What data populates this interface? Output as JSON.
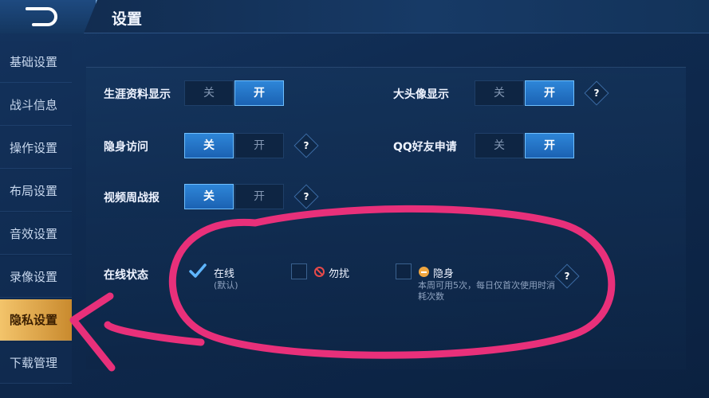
{
  "header": {
    "title": "设置"
  },
  "sidebar": {
    "items": [
      {
        "label": "基础设置"
      },
      {
        "label": "战斗信息"
      },
      {
        "label": "操作设置"
      },
      {
        "label": "布局设置"
      },
      {
        "label": "音效设置"
      },
      {
        "label": "录像设置"
      },
      {
        "label": "隐私设置",
        "active": true
      },
      {
        "label": "下载管理"
      }
    ]
  },
  "settings": {
    "off_label": "关",
    "on_label": "开",
    "help_label": "?",
    "career_display": {
      "label": "生涯资料显示",
      "value": "开"
    },
    "avatar_display": {
      "label": "大头像显示",
      "value": "开"
    },
    "stealth_visit": {
      "label": "隐身访问",
      "value": "关"
    },
    "qq_friend_request": {
      "label": "QQ好友申请",
      "value": "开"
    },
    "weekly_video_report": {
      "label": "视频周战报",
      "value": "关"
    }
  },
  "online_status": {
    "label": "在线状态",
    "selected": "在线",
    "options": [
      {
        "label": "在线",
        "note": "(默认)",
        "checked": true
      },
      {
        "label": "勿扰",
        "checked": false
      },
      {
        "label": "隐身",
        "note": "本周可用5次，每日仅首次使用时消耗次数",
        "checked": false
      }
    ]
  },
  "colors": {
    "accent": "#2e86d8",
    "active_tab": "#f3c46b",
    "annotation": "#e8307a"
  }
}
